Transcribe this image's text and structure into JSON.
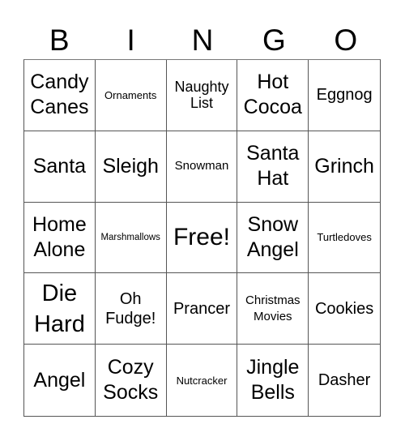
{
  "header": {
    "letters": [
      "B",
      "I",
      "N",
      "G",
      "O"
    ]
  },
  "card": {
    "rows": [
      [
        "Candy Canes",
        "Ornaments",
        "Naughty List",
        "Hot Cocoa",
        "Eggnog"
      ],
      [
        "Santa",
        "Sleigh",
        "Snowman",
        "Santa Hat",
        "Grinch"
      ],
      [
        "Home Alone",
        "Marshmallows",
        "Free!",
        "Snow Angel",
        "Turtledoves"
      ],
      [
        "Die Hard",
        "Oh Fudge!",
        "Prancer",
        "Christmas Movies",
        "Cookies"
      ],
      [
        "Angel",
        "Cozy Socks",
        "Nutcracker",
        "Jingle Bells",
        "Dasher"
      ]
    ]
  }
}
